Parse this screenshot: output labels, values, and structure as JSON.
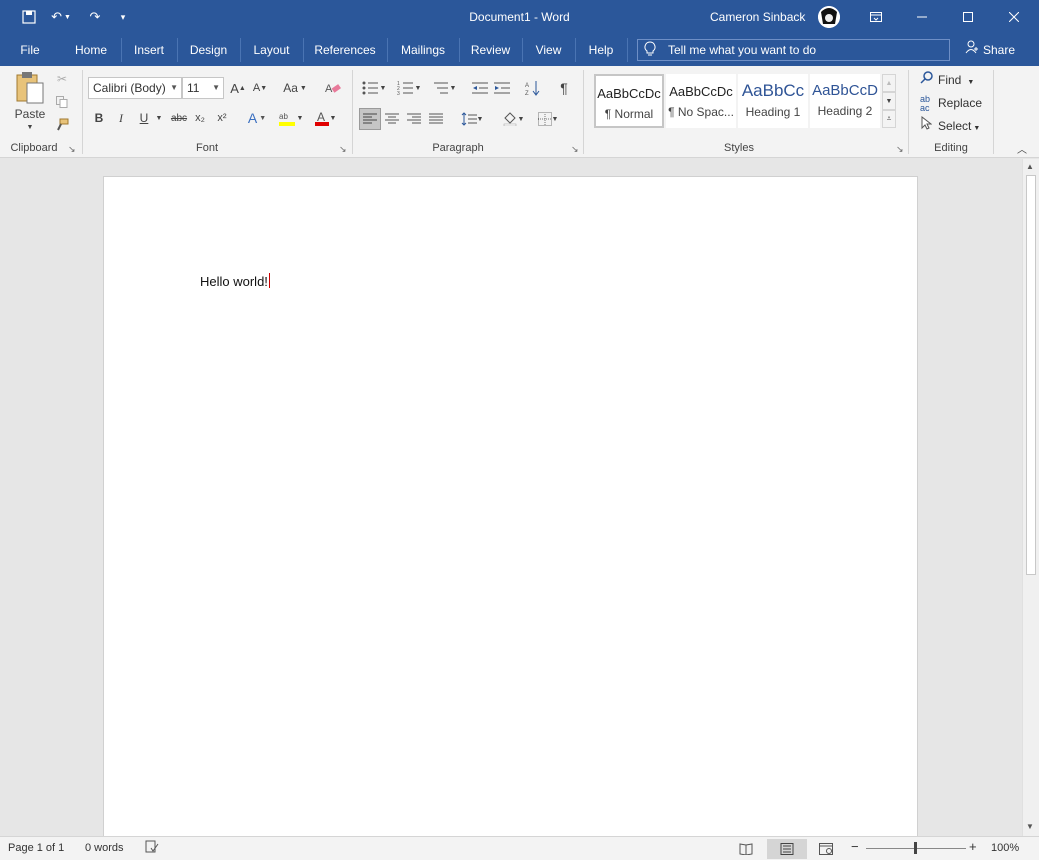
{
  "titlebar": {
    "title": "Document1  -  Word",
    "user": "Cameron Sinback",
    "qat": {
      "save_icon": "save-icon",
      "undo_icon": "undo-icon",
      "redo_icon": "redo-icon",
      "customize_icon": "chevron-down-icon"
    },
    "window_buttons": [
      "ribbon-display-options",
      "minimize",
      "maximize",
      "close"
    ]
  },
  "tabs": [
    "File",
    "Home",
    "Insert",
    "Design",
    "Layout",
    "References",
    "Mailings",
    "Review",
    "View",
    "Help"
  ],
  "tellme": {
    "placeholder": "Tell me what you want to do"
  },
  "share": {
    "label": "Share"
  },
  "ribbon": {
    "clipboard": {
      "label": "Clipboard",
      "paste": "Paste"
    },
    "font": {
      "label": "Font",
      "family": "Calibri (Body)",
      "size": "11",
      "case_label": "Aa",
      "bold": "B",
      "italic": "I",
      "underline": "U",
      "strike": "abc",
      "subscript": "x₂",
      "superscript": "x²"
    },
    "paragraph": {
      "label": "Paragraph"
    },
    "styles": {
      "label": "Styles",
      "items": [
        {
          "sample": "AaBbCcDc",
          "name": "¶ Normal"
        },
        {
          "sample": "AaBbCcDc",
          "name": "¶ No Spac..."
        },
        {
          "sample": "AaBbCc",
          "name": "Heading 1"
        },
        {
          "sample": "AaBbCcD",
          "name": "Heading 2"
        }
      ]
    },
    "editing": {
      "label": "Editing",
      "find": "Find",
      "replace": "Replace",
      "select": "Select"
    }
  },
  "document": {
    "text": "Hello world!"
  },
  "statusbar": {
    "page": "Page 1 of 1",
    "words": "0 words",
    "zoom": "100%"
  }
}
